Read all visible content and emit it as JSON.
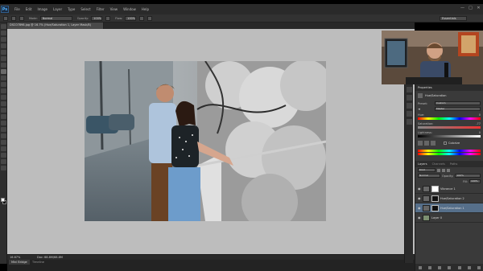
{
  "app": {
    "logo": "Ps",
    "menu": [
      "File",
      "Edit",
      "Image",
      "Layer",
      "Type",
      "Select",
      "Filter",
      "View",
      "Window",
      "Help"
    ],
    "window_controls": [
      "—",
      "□",
      "✕"
    ]
  },
  "options": {
    "mode_label": "Mode:",
    "mode_value": "Normal",
    "opacity_label": "Opacity:",
    "opacity_value": "100%",
    "flow_label": "Flow:",
    "flow_value": "100%",
    "workspace": "Essentials"
  },
  "document": {
    "tab_title": "DSC07898.jpg @ 16.7% (Hue/Saturation 1, Layer Mask/8)"
  },
  "status": {
    "zoom": "16.67%",
    "doc_size": "Doc: 68.8M/68.8M"
  },
  "mini_bridge": {
    "tabs": [
      "Mini Bridge",
      "Timeline"
    ]
  },
  "properties": {
    "tab": "Properties",
    "title": "Hue/Saturation",
    "preset_label": "Preset:",
    "preset_value": "Custom",
    "channel_value": "Master",
    "hue_label": "Hue:",
    "hue_value": "0",
    "saturation_label": "Saturation:",
    "saturation_value": "-77",
    "lightness_label": "Lightness:",
    "lightness_value": "0",
    "colorize_label": "Colorize"
  },
  "layers": {
    "tabs": [
      "Layers",
      "Channels",
      "Paths"
    ],
    "kind_value": "Kind",
    "blend_value": "Normal",
    "opacity_label": "Opacity:",
    "opacity_value": "100%",
    "fill_label": "Fill:",
    "fill_value": "100%",
    "items": [
      {
        "name": "Vibrance 1",
        "selected": false
      },
      {
        "name": "Hue/Saturation 2",
        "selected": false
      },
      {
        "name": "Hue/Saturation 1",
        "selected": true
      },
      {
        "name": "Layer 0",
        "selected": false
      }
    ]
  },
  "colors": {
    "panel_bg": "#3a3a3a",
    "canvas_bg": "#bdbdbd",
    "selected_layer": "#566f8a"
  }
}
